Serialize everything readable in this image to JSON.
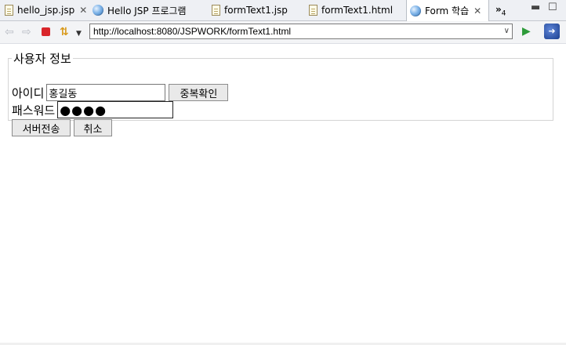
{
  "tabs": [
    {
      "label": "hello_jsp.jsp",
      "icon": "jsp-file-icon",
      "closable": true,
      "active": false
    },
    {
      "label": "Hello JSP 프로그램",
      "icon": "globe-icon",
      "closable": false,
      "active": false
    },
    {
      "label": "formText1.jsp",
      "icon": "jsp-file-icon",
      "closable": false,
      "active": false
    },
    {
      "label": "formText1.html",
      "icon": "html-file-icon",
      "closable": false,
      "active": false
    },
    {
      "label": "Form 학습",
      "icon": "globe-icon",
      "closable": true,
      "active": true
    }
  ],
  "tab_overflow": {
    "symbol": "»",
    "count": "4"
  },
  "toolbar": {
    "url": "http://localhost:8080/JSPWORK/formText1.html"
  },
  "form": {
    "legend": "사용자 정보",
    "id_label": "아이디",
    "id_value": "홍길동",
    "dup_check_button": "중복확인",
    "pw_label": "패스워드",
    "pw_value": "●●●●",
    "submit_button": "서버전송",
    "cancel_button": "취소"
  },
  "colors": {
    "stop_button": "#d9262b",
    "go_arrow": "#2e9b3a",
    "active_tab": "#ffffff",
    "tabbar_bg": "#eef0f4"
  }
}
